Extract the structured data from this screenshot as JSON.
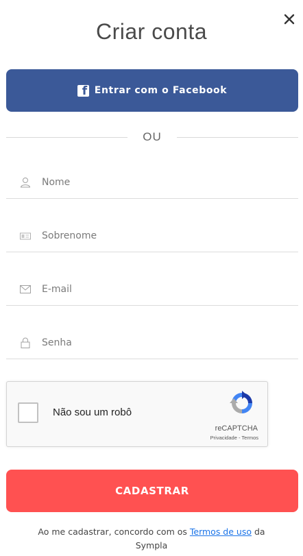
{
  "modal": {
    "title": "Criar conta",
    "close_icon": "close-icon"
  },
  "facebook": {
    "label": "Entrar com o Facebook",
    "icon": "facebook-icon",
    "color": "#3b5998"
  },
  "divider": {
    "label": "OU"
  },
  "fields": {
    "nome": {
      "placeholder": "Nome",
      "value": "",
      "icon": "user-icon"
    },
    "sobrenome": {
      "placeholder": "Sobrenome",
      "value": "",
      "icon": "id-card-icon"
    },
    "email": {
      "placeholder": "E-mail",
      "value": "",
      "icon": "envelope-icon"
    },
    "senha": {
      "placeholder": "Senha",
      "value": "",
      "icon": "lock-icon"
    }
  },
  "recaptcha": {
    "label": "Não sou um robô",
    "brand": "reCAPTCHA",
    "privacy": "Privacidade",
    "separator": " - ",
    "terms": "Termos",
    "checked": false
  },
  "submit": {
    "label": "CADASTRAR",
    "color": "#ff5151"
  },
  "footer": {
    "text_before": "Ao me cadastrar, concordo com os ",
    "link": "Termos de uso",
    "text_after": " da",
    "line2": "Sympla"
  }
}
